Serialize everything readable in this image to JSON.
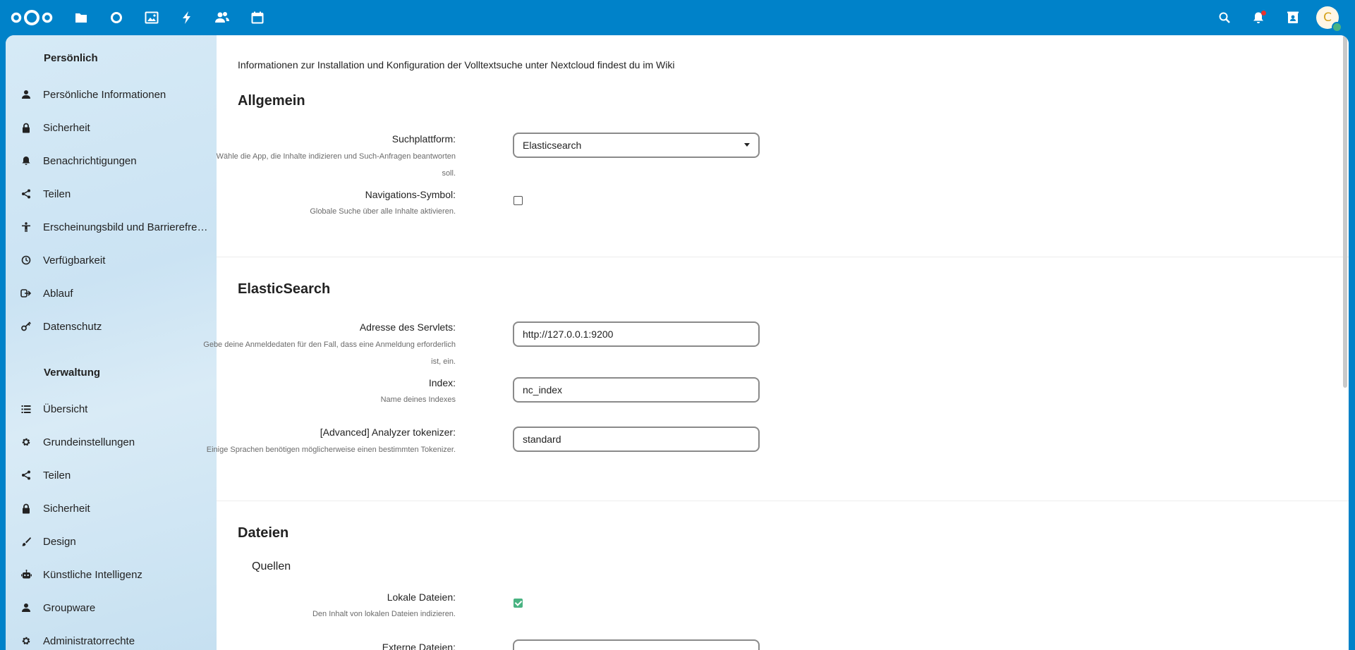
{
  "header": {
    "logo": "nextcloud-logo",
    "apps": [
      "files-icon",
      "dashboard-icon",
      "photos-icon",
      "activity-icon",
      "contacts-icon",
      "calendar-icon"
    ],
    "right": [
      "search-icon",
      "bell-icon",
      "contacts-menu-icon"
    ],
    "avatar_initial": "C"
  },
  "sidebar": {
    "personal_caption": "Persönlich",
    "personal_items": [
      {
        "label": "Persönliche Informationen",
        "icon": "person-icon"
      },
      {
        "label": "Sicherheit",
        "icon": "lock-icon"
      },
      {
        "label": "Benachrichtigungen",
        "icon": "bell-icon"
      },
      {
        "label": "Teilen",
        "icon": "share-icon"
      },
      {
        "label": "Erscheinungsbild und Barrierefreiheit",
        "icon": "accessibility-icon"
      },
      {
        "label": "Verfügbarkeit",
        "icon": "clock-icon"
      },
      {
        "label": "Ablauf",
        "icon": "flow-icon"
      },
      {
        "label": "Datenschutz",
        "icon": "key-icon"
      }
    ],
    "admin_caption": "Verwaltung",
    "admin_items": [
      {
        "label": "Übersicht",
        "icon": "list-icon"
      },
      {
        "label": "Grundeinstellungen",
        "icon": "gear-icon"
      },
      {
        "label": "Teilen",
        "icon": "share-icon"
      },
      {
        "label": "Sicherheit",
        "icon": "lock-icon"
      },
      {
        "label": "Design",
        "icon": "brush-icon"
      },
      {
        "label": "Künstliche Intelligenz",
        "icon": "robot-icon"
      },
      {
        "label": "Groupware",
        "icon": "groupware-icon"
      },
      {
        "label": "Administratorrechte",
        "icon": "gear-icon"
      }
    ]
  },
  "main": {
    "wiki_text": "Informationen zur Installation und Konfiguration der Volltextsuche unter Nextcloud findest du im Wiki",
    "general": {
      "title": "Allgemein",
      "platform_label": "Suchplattform:",
      "platform_hint": "Wähle die App, die Inhalte indizieren und Such-Anfragen beantworten soll.",
      "platform_value": "Elasticsearch",
      "nav_label": "Navigations-Symbol:",
      "nav_hint": "Globale Suche über alle Inhalte aktivieren.",
      "nav_checked": false
    },
    "elastic": {
      "title": "ElasticSearch",
      "address_label": "Adresse des Servlets:",
      "address_hint": "Gebe deine Anmeldedaten für den Fall, dass eine Anmeldung erforderlich ist, ein.",
      "address_value": "http://127.0.0.1:9200",
      "index_label": "Index:",
      "index_hint": "Name deines Indexes",
      "index_value": "nc_index",
      "analyzer_label": "[Advanced] Analyzer tokenizer:",
      "analyzer_hint": "Einige Sprachen benötigen möglicherweise einen bestimmten Tokenizer.",
      "analyzer_value": "standard"
    },
    "files": {
      "title": "Dateien",
      "sources_title": "Quellen",
      "local_label": "Lokale Dateien:",
      "local_hint": "Den Inhalt von lokalen Dateien indizieren.",
      "local_checked": true,
      "external_label": "Externe Dateien:"
    }
  },
  "colors": {
    "header": "#0082c9",
    "accent_check": "#49b382"
  }
}
